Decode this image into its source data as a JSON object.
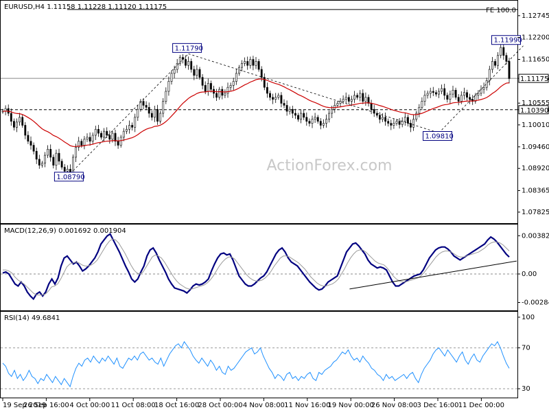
{
  "header": {
    "symbol_title": "EURUSD,H4  1.11158 1.11228 1.11120 1.11175",
    "fe_label": "FE 100.0",
    "watermark": "ActionForex.com"
  },
  "chart_data": [
    {
      "type": "candlestick",
      "title": "EURUSD,H4  1.11158 1.11228 1.11120 1.11175",
      "ylim": [
        1.076,
        1.13
      ],
      "y_ticks": [
        "1.12745",
        "1.12200",
        "1.11650",
        "1.11175",
        "1.10555",
        "1.10390",
        "1.10010",
        "1.09460",
        "1.08920",
        "1.08365",
        "1.07825"
      ],
      "current_price": {
        "value": 1.11175,
        "label": "1.11175"
      },
      "horizontal_levels": [
        {
          "value": 1.1039,
          "label": "1.10390",
          "style": "dashed"
        },
        {
          "value": 1.11175,
          "style": "solid"
        },
        {
          "value": 1.129,
          "label": "FE 100.0",
          "style": "solid"
        }
      ],
      "annotations": [
        {
          "label": "1.08790",
          "value": 1.0879,
          "x_index": 24
        },
        {
          "label": "1.11790",
          "value": 1.1179,
          "x_index": 66
        },
        {
          "label": "1.09810",
          "value": 1.0981,
          "x_index": 155
        },
        {
          "label": "1.11990",
          "value": 1.1199,
          "x_index": 185
        }
      ],
      "moving_average_color": "#cc0000",
      "candle_up_color": "#ffffff",
      "candle_down_color": "#000000",
      "watermark": "ActionForex.com",
      "closes": [
        1.1035,
        1.1042,
        1.103,
        1.101,
        1.0995,
        1.1008,
        1.102,
        1.1,
        1.0975,
        1.096,
        1.095,
        1.0935,
        1.0915,
        1.09,
        1.0905,
        1.0925,
        1.094,
        1.092,
        1.09,
        1.093,
        1.091,
        1.0895,
        1.0885,
        1.089,
        1.088,
        1.092,
        1.0945,
        1.096,
        1.095,
        1.0965,
        1.097,
        1.096,
        1.0975,
        1.099,
        1.098,
        1.097,
        1.0985,
        1.0975,
        1.0965,
        1.098,
        1.096,
        1.095,
        1.097,
        1.0985,
        1.099,
        1.1,
        1.0995,
        1.102,
        1.104,
        1.106,
        1.105,
        1.1045,
        1.103,
        1.102,
        1.104,
        1.101,
        1.103,
        1.106,
        1.1085,
        1.111,
        1.113,
        1.114,
        1.1155,
        1.117,
        1.1165,
        1.115,
        1.116,
        1.114,
        1.1125,
        1.114,
        1.112,
        1.11,
        1.1085,
        1.1105,
        1.109,
        1.108,
        1.107,
        1.109,
        1.1075,
        1.108,
        1.1095,
        1.11,
        1.111,
        1.113,
        1.1145,
        1.1155,
        1.116,
        1.115,
        1.1165,
        1.115,
        1.116,
        1.114,
        1.112,
        1.1095,
        1.108,
        1.107,
        1.1065,
        1.107,
        1.1075,
        1.1055,
        1.105,
        1.1035,
        1.104,
        1.103,
        1.1025,
        1.1015,
        1.103,
        1.102,
        1.101,
        1.1005,
        1.1015,
        1.102,
        1.101,
        1.1,
        1.1005,
        1.1015,
        1.103,
        1.104,
        1.105,
        1.1055,
        1.106,
        1.1065,
        1.107,
        1.106,
        1.1065,
        1.1075,
        1.107,
        1.108,
        1.106,
        1.107,
        1.1055,
        1.104,
        1.103,
        1.1025,
        1.1015,
        1.102,
        1.101,
        1.1005,
        1.1,
        1.1005,
        1.101,
        1.1002,
        1.101,
        1.102,
        1.1005,
        1.0995,
        1.1015,
        1.103,
        1.1045,
        1.106,
        1.1075,
        1.108,
        1.1085,
        1.1082,
        1.1078,
        1.1085,
        1.1092,
        1.1075,
        1.1065,
        1.1078,
        1.1088,
        1.107,
        1.106,
        1.1075,
        1.1082,
        1.107,
        1.1065,
        1.106,
        1.1075,
        1.108,
        1.109,
        1.1095,
        1.1112,
        1.114,
        1.116,
        1.115,
        1.1175,
        1.1195,
        1.1175,
        1.116,
        1.1117
      ]
    },
    {
      "type": "line",
      "title": "MACD(12,26,9) 0.001692 0.001904",
      "ylim": [
        -0.0035,
        0.0046
      ],
      "y_ticks": [
        "0.003826",
        "0.00",
        "-0.002849"
      ],
      "series": [
        {
          "name": "MACD",
          "color": "#000080",
          "values": [
            0.0001,
            0.0002,
            0.0,
            -0.0005,
            -0.001,
            -0.0012,
            -0.0008,
            -0.0012,
            -0.0018,
            -0.0022,
            -0.0025,
            -0.002,
            -0.0018,
            -0.0022,
            -0.0018,
            -0.001,
            -0.0005,
            -0.001,
            -0.0004,
            0.0008,
            0.0016,
            0.0018,
            0.0014,
            0.001,
            0.0012,
            0.0008,
            0.0003,
            0.0005,
            0.0008,
            0.0012,
            0.0016,
            0.0022,
            0.003,
            0.0034,
            0.0038,
            0.004,
            0.0034,
            0.0028,
            0.0022,
            0.0015,
            0.0008,
            0.0002,
            -0.0005,
            -0.0008,
            -0.0005,
            0.0002,
            0.0008,
            0.0018,
            0.0024,
            0.0026,
            0.0021,
            0.0014,
            0.0008,
            0.0002,
            -0.0005,
            -0.001,
            -0.0014,
            -0.0015,
            -0.0016,
            -0.0017,
            -0.0019,
            -0.0016,
            -0.0012,
            -0.001,
            -0.0011,
            -0.001,
            -0.0008,
            -0.0005,
            0.0003,
            0.001,
            0.0016,
            0.002,
            0.0021,
            0.0019,
            0.002,
            0.0014,
            0.0006,
            -0.0002,
            -0.0006,
            -0.001,
            -0.0012,
            -0.0012,
            -0.001,
            -0.0007,
            -0.0004,
            -0.0002,
            0.0002,
            0.0008,
            0.0014,
            0.002,
            0.0024,
            0.0026,
            0.0022,
            0.0016,
            0.0012,
            0.001,
            0.0008,
            0.0004,
            0.0,
            -0.0004,
            -0.0008,
            -0.0011,
            -0.0014,
            -0.0016,
            -0.0015,
            -0.0012,
            -0.0008,
            -0.0006,
            -0.0004,
            -0.0002,
            0.0006,
            0.0014,
            0.0022,
            0.0026,
            0.003,
            0.0031,
            0.0028,
            0.0024,
            0.002,
            0.0014,
            0.001,
            0.0008,
            0.0006,
            0.0007,
            0.0006,
            0.0004,
            -0.0002,
            -0.0008,
            -0.0012,
            -0.0012,
            -0.001,
            -0.0008,
            -0.0006,
            -0.0004,
            -0.0002,
            -0.0001,
            0.0,
            0.0004,
            0.001,
            0.0016,
            0.002,
            0.0024,
            0.0026,
            0.0027,
            0.0027,
            0.0025,
            0.0022,
            0.0018,
            0.0016,
            0.0014,
            0.0016,
            0.0018,
            0.002,
            0.0022,
            0.0024,
            0.0026,
            0.0028,
            0.003,
            0.0034,
            0.0037,
            0.0035,
            0.0032,
            0.0028,
            0.0024,
            0.002,
            0.0017
          ]
        },
        {
          "name": "Signal",
          "color": "#9a9a9a",
          "values": [
            0.0004,
            0.0004,
            0.0003,
            0.0001,
            -0.0003,
            -0.0006,
            -0.0008,
            -0.001,
            -0.0013,
            -0.0016,
            -0.0019,
            -0.0021,
            -0.0021,
            -0.0021,
            -0.002,
            -0.0017,
            -0.0013,
            -0.0012,
            -0.001,
            -0.0005,
            0.0001,
            0.0007,
            0.001,
            0.0011,
            0.0012,
            0.0011,
            0.0009,
            0.0008,
            0.0008,
            0.0009,
            0.0011,
            0.0014,
            0.0019,
            0.0024,
            0.0029,
            0.0033,
            0.0035,
            0.0034,
            0.0031,
            0.0026,
            0.0021,
            0.0015,
            0.0009,
            0.0004,
            0.0001,
            0.0,
            0.0002,
            0.0007,
            0.0012,
            0.0017,
            0.0019,
            0.0018,
            0.0016,
            0.0012,
            0.0007,
            0.0002,
            -0.0003,
            -0.0007,
            -0.001,
            -0.0012,
            -0.0014,
            -0.0015,
            -0.0015,
            -0.0014,
            -0.0013,
            -0.0012,
            -0.0011,
            -0.0009,
            -0.0006,
            -0.0002,
            0.0003,
            0.0008,
            0.0012,
            0.0015,
            0.0017,
            0.0017,
            0.0015,
            0.0011,
            0.0007,
            0.0003,
            -0.0001,
            -0.0004,
            -0.0006,
            -0.0007,
            -0.0007,
            -0.0006,
            -0.0004,
            -0.0001,
            0.0003,
            0.0008,
            0.0012,
            0.0016,
            0.0018,
            0.0018,
            0.0017,
            0.0015,
            0.0013,
            0.0011,
            0.0008,
            0.0005,
            0.0001,
            -0.0003,
            -0.0006,
            -0.0009,
            -0.0011,
            -0.0012,
            -0.0012,
            -0.0011,
            -0.001,
            -0.0008,
            -0.0005,
            0.0,
            0.0005,
            0.0011,
            0.0016,
            0.002,
            0.0023,
            0.0024,
            0.0024,
            0.0022,
            0.0019,
            0.0016,
            0.0013,
            0.0011,
            0.001,
            0.0009,
            0.0006,
            0.0002,
            -0.0002,
            -0.0005,
            -0.0007,
            -0.0008,
            -0.0008,
            -0.0007,
            -0.0006,
            -0.0005,
            -0.0004,
            -0.0002,
            0.0001,
            0.0005,
            0.0009,
            0.0013,
            0.0017,
            0.002,
            0.0022,
            0.0023,
            0.0023,
            0.0022,
            0.002,
            0.0018,
            0.0017,
            0.0017,
            0.0018,
            0.0019,
            0.002,
            0.0021,
            0.0022,
            0.0024,
            0.0026,
            0.0029,
            0.0031,
            0.0032,
            0.0032,
            0.0031,
            0.0029,
            0.0026,
            0.0023
          ]
        }
      ],
      "trendline": {
        "from": [
          113,
          -0.0015
        ],
        "to": [
          185,
          0.001
        ]
      }
    },
    {
      "type": "line",
      "title": "RSI(14) 49.6841",
      "ylim": [
        22,
        104
      ],
      "y_ticks": [
        "100",
        "70",
        "30"
      ],
      "levels": [
        70,
        30
      ],
      "series": [
        {
          "name": "RSI",
          "color": "#1e90ff",
          "values": [
            55,
            52,
            45,
            42,
            48,
            40,
            44,
            38,
            42,
            48,
            42,
            40,
            35,
            40,
            38,
            44,
            40,
            36,
            42,
            38,
            34,
            40,
            36,
            32,
            42,
            50,
            55,
            52,
            58,
            60,
            56,
            62,
            58,
            55,
            60,
            57,
            62,
            58,
            54,
            60,
            52,
            50,
            55,
            60,
            58,
            62,
            58,
            64,
            66,
            62,
            58,
            60,
            56,
            54,
            60,
            52,
            58,
            64,
            68,
            72,
            74,
            70,
            76,
            72,
            68,
            62,
            58,
            55,
            60,
            56,
            52,
            58,
            54,
            48,
            52,
            46,
            44,
            52,
            48,
            50,
            54,
            58,
            62,
            66,
            68,
            70,
            64,
            66,
            70,
            62,
            56,
            50,
            46,
            40,
            44,
            42,
            38,
            44,
            46,
            40,
            42,
            38,
            42,
            40,
            44,
            46,
            40,
            38,
            46,
            44,
            48,
            50,
            52,
            56,
            58,
            62,
            66,
            64,
            68,
            62,
            58,
            60,
            56,
            62,
            58,
            55,
            50,
            48,
            44,
            42,
            38,
            44,
            40,
            42,
            38,
            40,
            42,
            44,
            40,
            44,
            46,
            40,
            36,
            44,
            50,
            54,
            58,
            64,
            68,
            70,
            66,
            62,
            68,
            64,
            60,
            56,
            62,
            66,
            58,
            54,
            60,
            64,
            58,
            56,
            62,
            66,
            70,
            74,
            72,
            76,
            70,
            62,
            55,
            50
          ]
        }
      ]
    }
  ],
  "x_axis": {
    "tick_labels": [
      "19 Sep 2019",
      "26 Sep 16:00",
      "4 Oct 00:00",
      "11 Oct 08:00",
      "18 Oct 16:00",
      "28 Oct 00:00",
      "4 Nov 08:00",
      "11 Nov 16:00",
      "19 Nov 00:00",
      "26 Nov 08:00",
      "3 Dec 16:00",
      "11 Dec 00:00"
    ]
  },
  "colors": {
    "background": "#ffffff",
    "grid_border": "#000000",
    "label_box_border": "#000080"
  }
}
